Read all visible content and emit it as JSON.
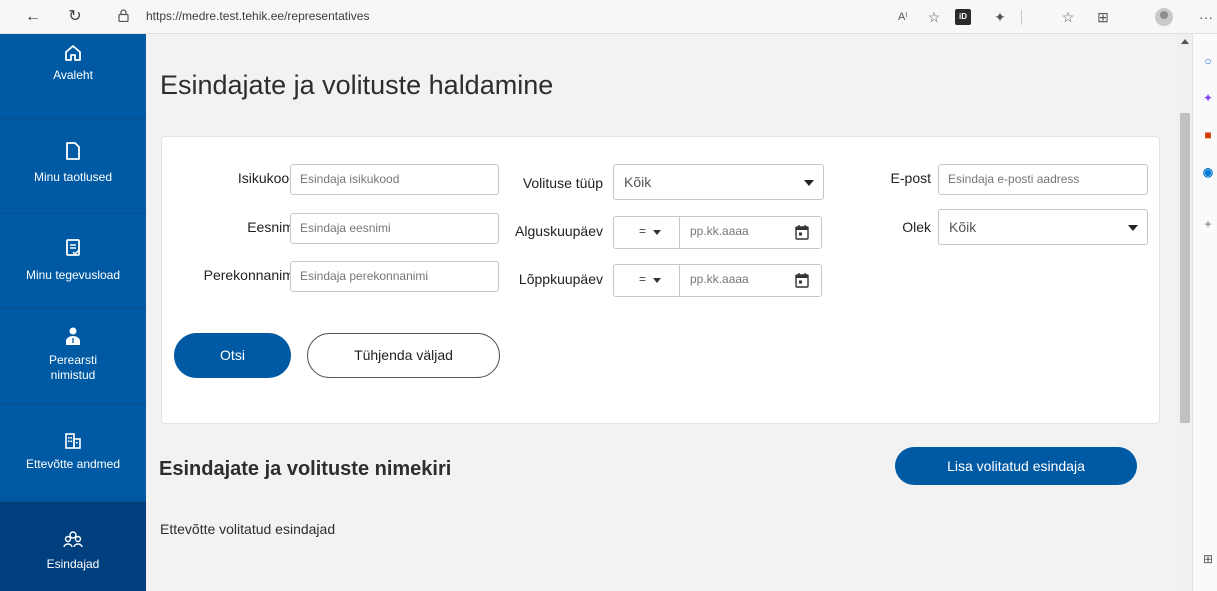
{
  "browser": {
    "url": "https://medre.test.tehik.ee/representatives",
    "id_label": "iD",
    "more_label": "···"
  },
  "sidebar": {
    "items": [
      {
        "label": "Avaleht",
        "icon": "home-icon"
      },
      {
        "label": "Minu taotlused",
        "icon": "document-icon"
      },
      {
        "label": "Minu tegevusload",
        "icon": "license-icon"
      },
      {
        "label": "Perearsti nimistud",
        "label_line1": "Perearsti",
        "label_line2": "nimistud",
        "icon": "doctor-icon"
      },
      {
        "label": "Ettevõtte andmed",
        "icon": "building-icon"
      },
      {
        "label": "Esindajad",
        "icon": "people-icon",
        "active": true
      }
    ]
  },
  "page": {
    "title": "Esindajate ja volituste haldamine"
  },
  "filters": {
    "isikukood": {
      "label": "Isikukood",
      "placeholder": "Esindaja isikukood"
    },
    "eesnimi": {
      "label": "Eesnimi",
      "placeholder": "Esindaja eesnimi"
    },
    "perekonnanimi": {
      "label": "Perekonnanimi",
      "placeholder": "Esindaja perekonnanimi"
    },
    "volituse_tyyp": {
      "label": "Volituse tüüp",
      "value": "Kõik"
    },
    "alguskuupaev": {
      "label": "Alguskuupäev",
      "operator": "=",
      "placeholder": "pp.kk.aaaa"
    },
    "loppkuupaev": {
      "label": "Lõppkuupäev",
      "operator": "=",
      "placeholder": "pp.kk.aaaa"
    },
    "epost": {
      "label": "E-post",
      "placeholder": "Esindaja e-posti aadress"
    },
    "olek": {
      "label": "Olek",
      "value": "Kõik"
    },
    "search_label": "Otsi",
    "clear_label": "Tühjenda väljad"
  },
  "list": {
    "title": "Esindajate ja volituste nimekiri",
    "add_label": "Lisa volitatud esindaja",
    "subtitle": "Ettevõtte volitatud esindajad"
  },
  "colors": {
    "primary": "#005aa3",
    "sidebar_active": "#003f7d"
  }
}
